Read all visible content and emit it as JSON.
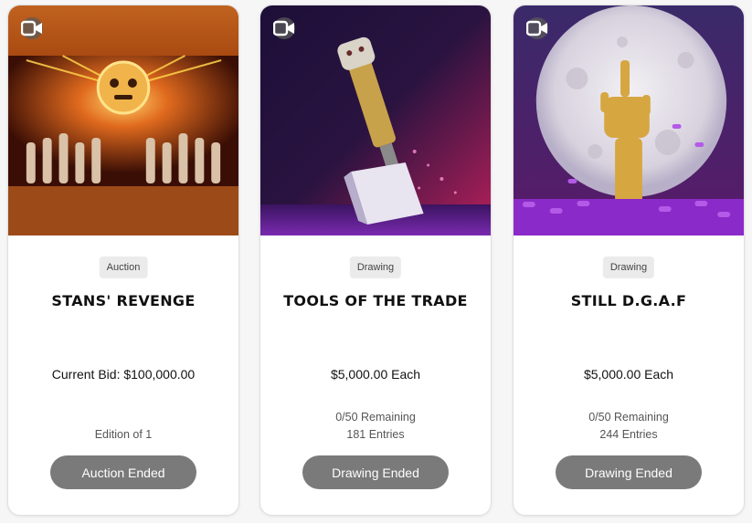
{
  "cards": [
    {
      "type_tag": "Auction",
      "title": "STANS' REVENGE",
      "price_text": "Current Bid: $100,000.00",
      "meta_line1": "Edition of 1",
      "button_label": "Auction Ended",
      "media_icon": "video-camera-icon"
    },
    {
      "type_tag": "Drawing",
      "title": "TOOLS OF THE TRADE",
      "price_text": "$5,000.00 Each",
      "meta_line1": "0/50 Remaining",
      "meta_line2": "181 Entries",
      "button_label": "Drawing Ended",
      "media_icon": "video-camera-icon"
    },
    {
      "type_tag": "Drawing",
      "title": "STILL D.G.A.F",
      "price_text": "$5,000.00 Each",
      "meta_line1": "0/50 Remaining",
      "meta_line2": "244 Entries",
      "button_label": "Drawing Ended",
      "media_icon": "video-camera-icon"
    }
  ],
  "colors": {
    "button_disabled": "#7a7a7a",
    "tag_background": "#ebebeb",
    "card_background": "#ffffff"
  }
}
